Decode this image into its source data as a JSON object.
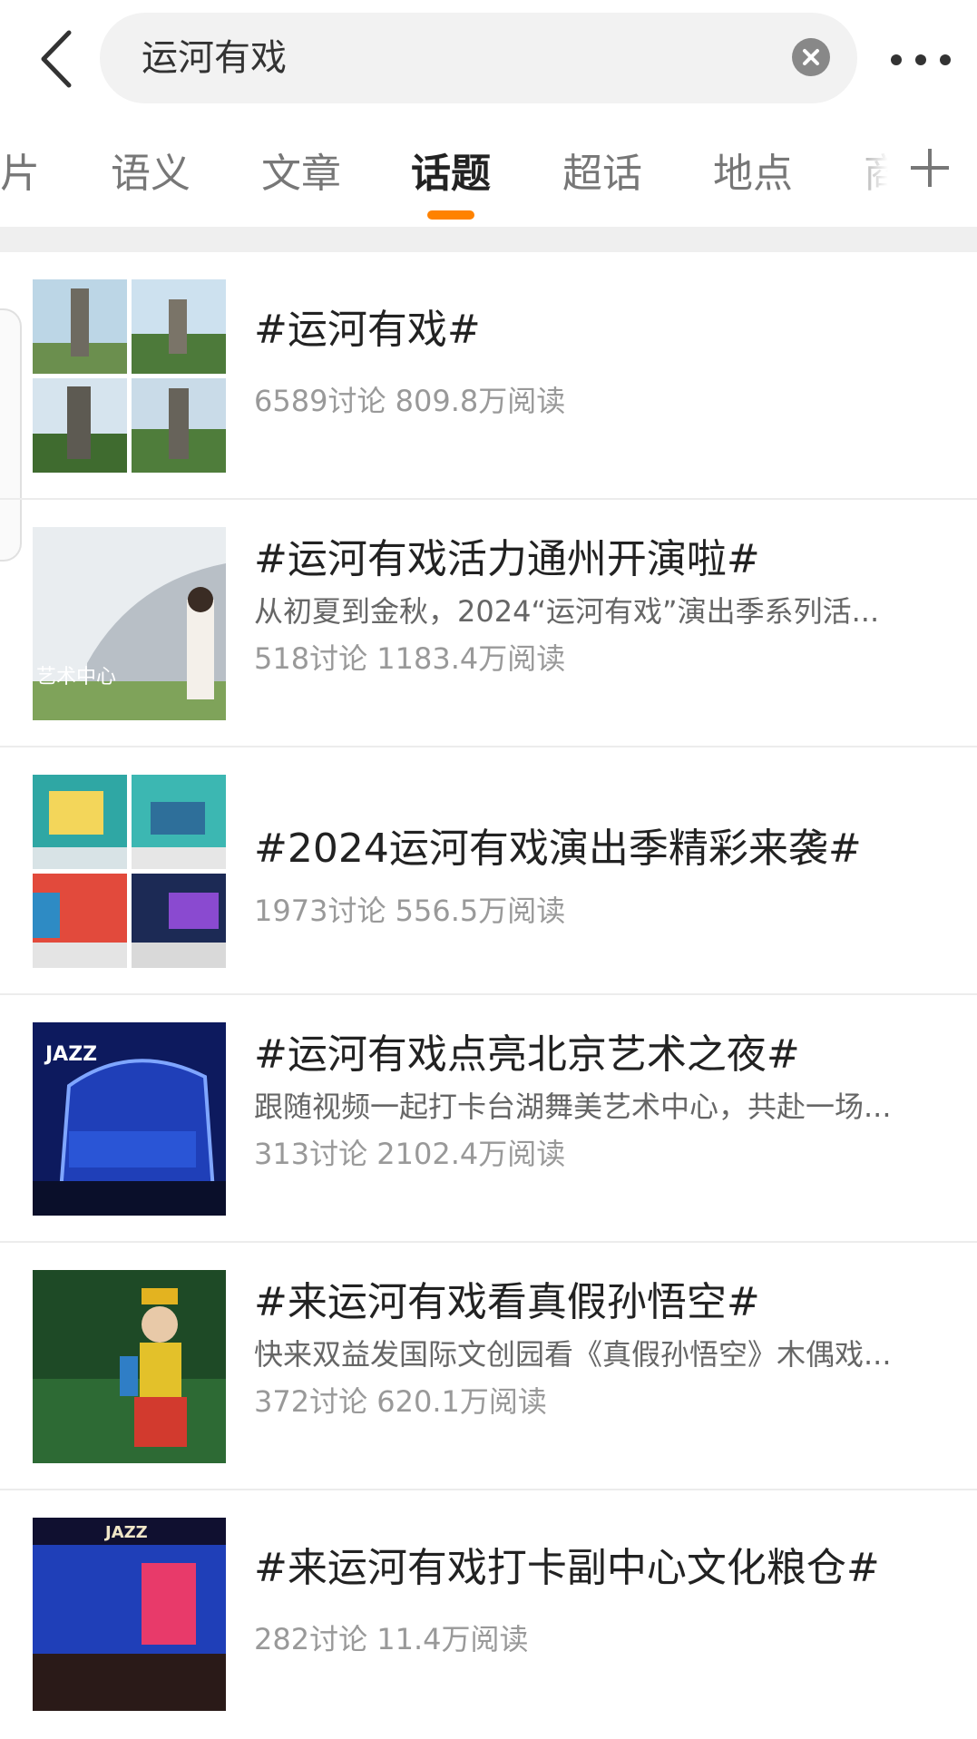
{
  "search": {
    "query": "运河有戏"
  },
  "tabs": [
    {
      "label": "片"
    },
    {
      "label": "语义"
    },
    {
      "label": "文章"
    },
    {
      "label": "话题"
    },
    {
      "label": "超话"
    },
    {
      "label": "地点"
    },
    {
      "label": "商"
    }
  ],
  "active_tab": "话题",
  "colors": {
    "accent": "#ff8200",
    "title": "#222222",
    "meta": "#999999"
  },
  "results": [
    {
      "title": "#运河有戏#",
      "desc": "",
      "stats": "6589讨论 809.8万阅读"
    },
    {
      "title": "#运河有戏活力通州开演啦#",
      "desc": "从初夏到金秋，2024“运河有戏”演出季系列活...",
      "stats": "518讨论 1183.4万阅读",
      "thumb_text": "艺术中心"
    },
    {
      "title": "#2024运河有戏演出季精彩来袭#",
      "desc": "",
      "stats": "1973讨论 556.5万阅读"
    },
    {
      "title": "#运河有戏点亮北京艺术之夜#",
      "desc": "跟随视频一起打卡台湖舞美艺术中心，共赴一场...",
      "stats": "313讨论 2102.4万阅读",
      "thumb_text": "JAZZ"
    },
    {
      "title": "#来运河有戏看真假孙悟空#",
      "desc": "快来双益发国际文创园看《真假孙悟空》木偶戏...",
      "stats": "372讨论 620.1万阅读"
    },
    {
      "title": "#来运河有戏打卡副中心文化粮仓#",
      "desc": "",
      "stats": "282讨论 11.4万阅读",
      "thumb_text": "JAZZ"
    }
  ]
}
